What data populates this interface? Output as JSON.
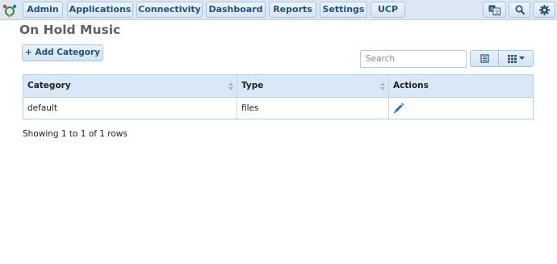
{
  "nav": {
    "items": [
      {
        "label": "Admin"
      },
      {
        "label": "Applications"
      },
      {
        "label": "Connectivity"
      },
      {
        "label": "Dashboard"
      },
      {
        "label": "Reports"
      },
      {
        "label": "Settings"
      },
      {
        "label": "UCP"
      }
    ],
    "icons": [
      "language-icon",
      "search-icon",
      "gear-icon"
    ]
  },
  "page": {
    "title": "On Hold Music",
    "add_button_label": "+ Add Category"
  },
  "toolbar": {
    "search_placeholder": "Search"
  },
  "table": {
    "columns": [
      "Category",
      "Type",
      "Actions"
    ],
    "rows": [
      {
        "category": "default",
        "type": "files",
        "action_icon": "edit-pencil-icon"
      }
    ],
    "footer": "Showing 1 to 1 of 1 rows"
  },
  "colors": {
    "accent": "#23527c",
    "header_bg": "#d8e8f6",
    "topbar_bg": "#dbe8f4",
    "edit_icon": "#2a6ab8"
  }
}
